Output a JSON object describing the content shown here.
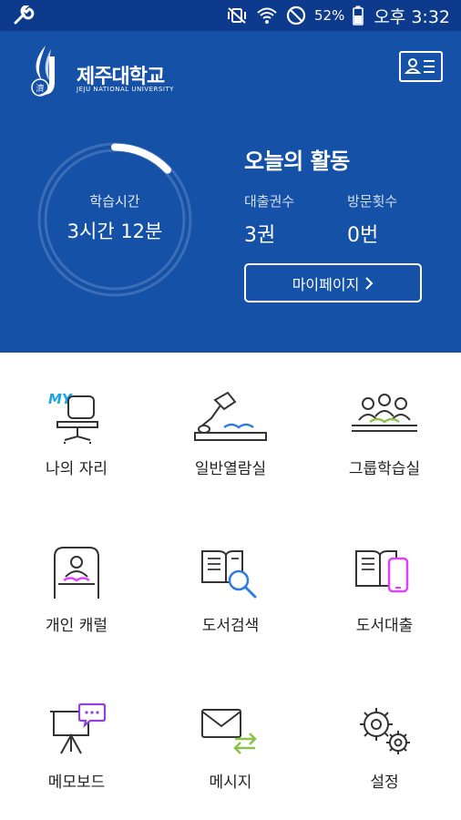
{
  "status_bar": {
    "battery": "52%",
    "time": "오후 3:32"
  },
  "header": {
    "logo_text": "제주대학교",
    "logo_subtext": "JEJU NATIONAL UNIVERSITY"
  },
  "study_time": {
    "label": "학습시간",
    "value": "3시간 12분",
    "progress": 0.13
  },
  "activity": {
    "title": "오늘의 활동",
    "loans_label": "대출권수",
    "loans_value": "3권",
    "visits_label": "방문횟수",
    "visits_value": "0번",
    "mypage_label": "마이페이지"
  },
  "menu": {
    "items": [
      {
        "label": "나의 자리",
        "icon": "my-seat-icon",
        "icon_text": "MY"
      },
      {
        "label": "일반열람실",
        "icon": "reading-room-icon"
      },
      {
        "label": "그룹학습실",
        "icon": "group-study-icon"
      },
      {
        "label": "개인 캐럴",
        "icon": "carrel-icon"
      },
      {
        "label": "도서검색",
        "icon": "book-search-icon"
      },
      {
        "label": "도서대출",
        "icon": "book-loan-icon"
      },
      {
        "label": "메모보드",
        "icon": "memo-board-icon"
      },
      {
        "label": "메시지",
        "icon": "message-icon"
      },
      {
        "label": "설정",
        "icon": "settings-icon"
      }
    ]
  },
  "colors": {
    "primary": "#1451a7",
    "status_bar": "#0d3a8c",
    "accent_green": "#8bc34a",
    "accent_pink": "#e040fb",
    "accent_blue": "#2f7be0"
  }
}
